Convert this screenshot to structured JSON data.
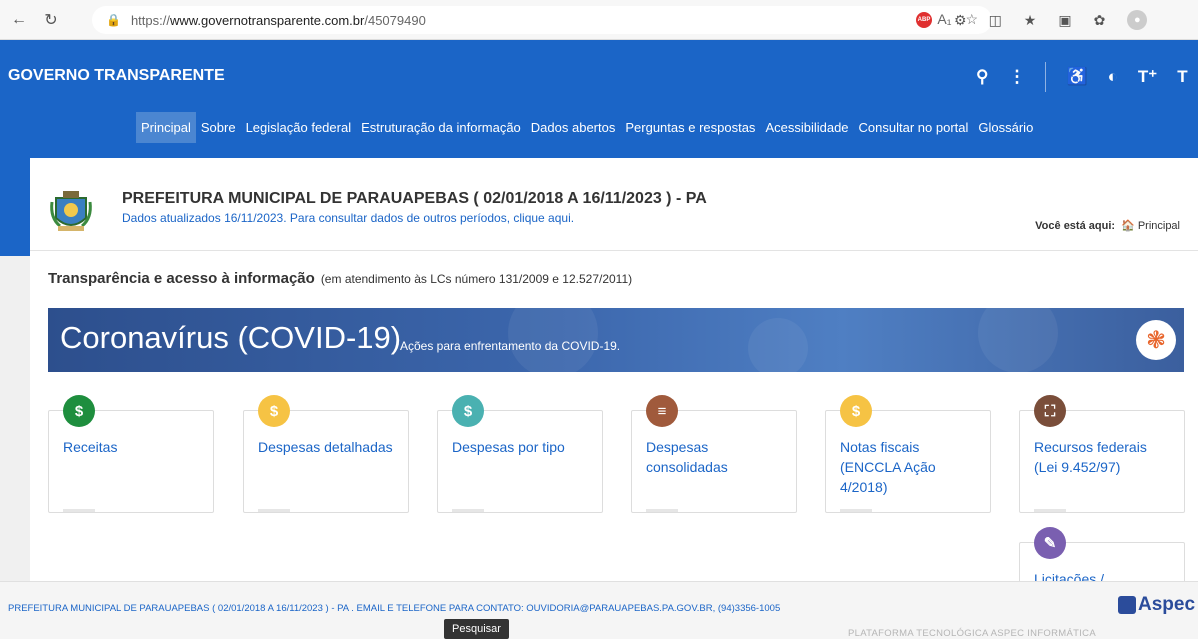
{
  "browser": {
    "url_prefix": "https://",
    "url_host": "www.governotransparente.com.br",
    "url_path": "/45079490"
  },
  "header": {
    "brand": "GOVERNO TRANSPARENTE",
    "nav": [
      "Principal",
      "Sobre",
      "Legislação federal",
      "Estruturação da informação",
      "Dados abertos",
      "Perguntas e respostas",
      "Acessibilidade",
      "Consultar no portal",
      "Glossário"
    ],
    "nav_active": "Principal"
  },
  "entity": {
    "title": "PREFEITURA MUNICIPAL DE PARAUAPEBAS ( 02/01/2018 A 16/11/2023 ) - PA",
    "subtitle": "Dados atualizados 16/11/2023. Para consultar dados de outros períodos, clique aqui.",
    "breadcrumb_label": "Você está aqui:",
    "breadcrumb_item": "Principal"
  },
  "transparency": {
    "title": "Transparência e acesso à informação",
    "note": "(em atendimento às LCs número 131/2009 e 12.527/2011)"
  },
  "covid": {
    "big": "Coronavírus (COVID-19)",
    "small": "Ações para enfrentamento da COVID-19."
  },
  "tiles": [
    {
      "label": "Receitas",
      "icon": "dollar-icon",
      "color": "#1e8e3e"
    },
    {
      "label": "Despesas detalhadas",
      "icon": "dollar-icon",
      "color": "#f6c344"
    },
    {
      "label": "Despesas por tipo",
      "icon": "dollar-icon",
      "color": "#4ab1b1"
    },
    {
      "label": "Despesas consolidadas",
      "icon": "list-icon",
      "color": "#a05a3c"
    },
    {
      "label": "Notas fiscais (ENCCLA Ação 4/2018)",
      "icon": "dollar-icon",
      "color": "#f6c344"
    },
    {
      "label": "Recursos federais (Lei 9.452/97)",
      "icon": "crop-icon",
      "color": "#7a4e3a"
    },
    {
      "label": "Licitações /",
      "icon": "pencil-icon",
      "color": "#7a5fb0"
    }
  ],
  "footer": {
    "text": "PREFEITURA MUNICIPAL DE PARAUAPEBAS ( 02/01/2018 A 16/11/2023 ) - PA . EMAIL E TELEFONE PARA CONTATO: OUVIDORIA@PARAUAPEBAS.PA.GOV.BR, (94)3356-1005",
    "brand": "Aspec",
    "platform": "PLATAFORMA TECNOLÓGICA ASPEC INFORMÁTICA",
    "tooltip": "Pesquisar"
  }
}
